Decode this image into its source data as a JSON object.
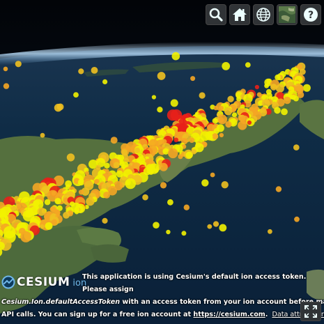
{
  "toolbar": {
    "buttons": [
      {
        "name": "geocoder-search",
        "icon": "search-icon"
      },
      {
        "name": "home",
        "icon": "home-icon"
      },
      {
        "name": "scene-mode",
        "icon": "globe-icon"
      },
      {
        "name": "base-layer-picker",
        "icon": "imagery-thumbnail"
      },
      {
        "name": "navigation-help",
        "icon": "question-mark-icon"
      }
    ]
  },
  "logo": {
    "brand": "CESIUM",
    "suffix": "ion"
  },
  "credit_message": {
    "line1": "This application is using Cesium's default ion access token. Please assign",
    "line2_code": "Cesium.Ion.defaultAccessToken",
    "line2_rest": " with an access token from your ion account before making any Cesium",
    "line3_start": "API calls. You can sign up for a free ion account at ",
    "link": "https://cesium.com",
    "line3_end": ".",
    "data_attribution": "Data attribution"
  },
  "colors": {
    "toolbar_bg": "#303336",
    "point_low": "#f2f200",
    "point_mid": "#f5a623",
    "point_high": "#e8201a",
    "ocean": "#0f2a44",
    "land": "#4a6a3a",
    "sky": "#050a14"
  }
}
